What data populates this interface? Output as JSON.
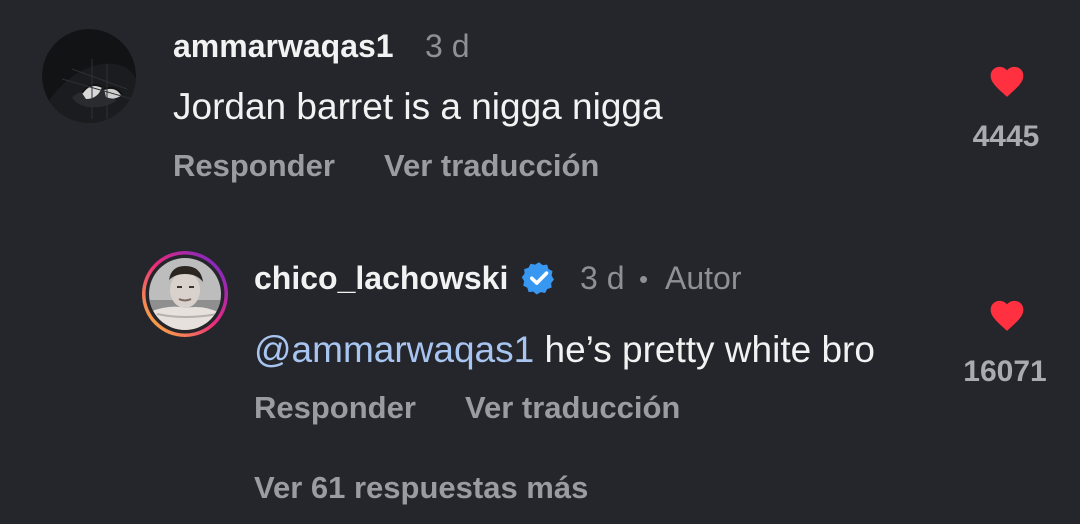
{
  "colors": {
    "background": "#25262b",
    "heart": "#ff3040",
    "mention": "#a7c5f0",
    "verified": "#3897f0"
  },
  "comment": {
    "username": "ammarwaqas1",
    "time": "3 d",
    "text": "Jordan barret is a nigga nigga",
    "reply_label": "Responder",
    "translate_label": "Ver traducción",
    "likes": "4445",
    "avatar_icon": "spider-mask-avatar"
  },
  "reply": {
    "username": "chico_lachowski",
    "verified_icon": "verified-badge-icon",
    "time": "3 d",
    "separator": "•",
    "author_label": "Autor",
    "mention": "@ammarwaqas1",
    "text": " he’s pretty white bro",
    "reply_label": "Responder",
    "translate_label": "Ver traducción",
    "likes": "16071"
  },
  "more_replies_label": "Ver 61 respuestas más"
}
